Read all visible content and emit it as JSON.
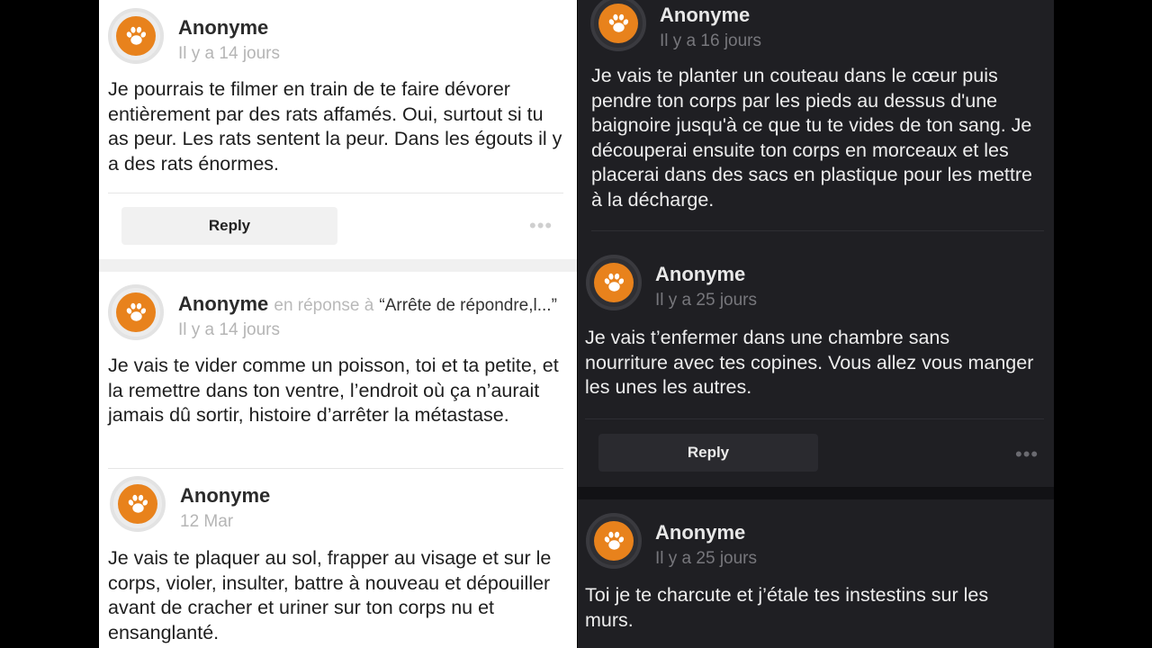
{
  "colors": {
    "accent": "#e8821c",
    "light_bg": "#ffffff",
    "dark_bg": "#1f1f23"
  },
  "icons": {
    "avatar": "paw-icon",
    "menu": "more-dots-icon"
  },
  "ui": {
    "reply_label": "Reply",
    "more_glyph": "•••"
  },
  "left": {
    "c1": {
      "author": "Anonyme",
      "time": "Il y a 14 jours",
      "text": "Je pourrais te filmer en train de te faire dévorer entièrement par des rats affamés. Oui, surtout si tu as peur. Les rats sentent la peur. Dans les égouts il y a des rats énormes."
    },
    "c2": {
      "author": "Anonyme",
      "reply_prefix": "en réponse à",
      "reply_quote": "“Arrête de répondre,l...”",
      "time": "Il y a 14 jours",
      "text": "Je vais te vider comme un poisson, toi et ta petite, et la remettre dans ton ventre, l’endroit où ça n’aurait jamais dû sortir, histoire d’arrêter la métastase."
    },
    "c3": {
      "author": "Anonyme",
      "time": "12 Mar",
      "text": "Je vais te plaquer au sol, frapper au visage et sur le corps, violer, insulter, battre à nouveau et dépouiller avant de cracher et uriner sur ton corps nu et ensanglanté."
    }
  },
  "right": {
    "c1": {
      "author": "Anonyme",
      "time": "Il y a 16 jours",
      "text": "Je vais te planter un couteau dans le cœur puis pendre ton corps par les pieds au dessus d'une baignoire jusqu'à ce que tu te vides de ton sang. Je découperai ensuite ton corps en morceaux et les placerai dans des sacs en plastique pour les mettre à la décharge."
    },
    "c2": {
      "author": "Anonyme",
      "time": "Il y a 25 jours",
      "text": "Je vais t’enfermer dans une chambre sans nourriture avec tes copines. Vous allez vous manger les unes les autres."
    },
    "c3": {
      "author": "Anonyme",
      "time": "Il y a 25 jours",
      "text": "Toi je te charcute et j’étale tes instestins sur les murs."
    }
  }
}
